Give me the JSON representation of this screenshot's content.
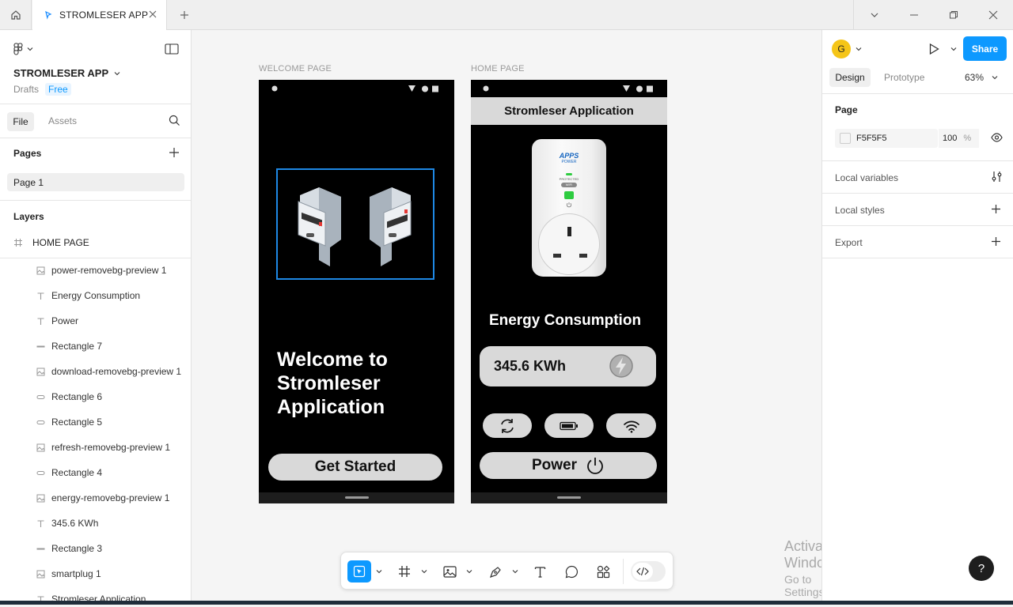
{
  "tabs": {
    "active_label": "STROMLESER APP"
  },
  "file": {
    "name": "STROMLESER APP",
    "location": "Drafts",
    "plan": "Free"
  },
  "left_tabs": {
    "file": "File",
    "assets": "Assets"
  },
  "pages": {
    "header": "Pages",
    "items": [
      "Page 1"
    ]
  },
  "layers": {
    "header": "Layers",
    "frame": "HOME PAGE",
    "items": [
      {
        "name": "power-removebg-preview 1",
        "icon": "image-icon"
      },
      {
        "name": "Energy Consumption",
        "icon": "text-icon"
      },
      {
        "name": "Power",
        "icon": "text-icon"
      },
      {
        "name": "Rectangle 7",
        "icon": "rectangle-icon"
      },
      {
        "name": "download-removebg-preview 1",
        "icon": "image-icon"
      },
      {
        "name": "Rectangle 6",
        "icon": "rounded-rectangle-icon"
      },
      {
        "name": "Rectangle 5",
        "icon": "rounded-rectangle-icon"
      },
      {
        "name": "refresh-removebg-preview 1",
        "icon": "image-icon"
      },
      {
        "name": "Rectangle 4",
        "icon": "rounded-rectangle-icon"
      },
      {
        "name": "energy-removebg-preview 1",
        "icon": "image-icon"
      },
      {
        "name": "345.6 KWh",
        "icon": "text-icon"
      },
      {
        "name": "Rectangle 3",
        "icon": "rectangle-icon"
      },
      {
        "name": "smartplug 1",
        "icon": "image-icon"
      },
      {
        "name": "Stromleser Application",
        "icon": "text-icon"
      }
    ]
  },
  "canvas": {
    "welcome": {
      "frame_label": "WELCOME PAGE",
      "heading_line1": "Welcome to",
      "heading_line2": "Stromleser",
      "heading_line3": "Application",
      "button": "Get Started"
    },
    "home": {
      "frame_label": "HOME PAGE",
      "app_title": "Stromleser Application",
      "plug_brand": "APPS",
      "plug_sub": "POWER",
      "plug_protected": "PROTECTED",
      "plug_wifi": "WIFI",
      "section_title": "Energy Consumption",
      "reading": "345.6 KWh",
      "power_button": "Power"
    }
  },
  "right_panel": {
    "avatar_letter": "G",
    "avatar_color": "#f5c518",
    "share": "Share",
    "tabs": {
      "design": "Design",
      "prototype": "Prototype"
    },
    "zoom": "63%",
    "page_header": "Page",
    "page_color": "F5F5F5",
    "page_opacity": "100",
    "opacity_unit": "%",
    "sections": [
      "Local variables",
      "Local styles",
      "Export"
    ]
  },
  "watermark": {
    "line1": "Activate Windows",
    "line2": "Go to Settings to activate Windows."
  },
  "help": "?",
  "colors": {
    "accent": "#0d99ff",
    "selection": "#1e88e5",
    "share_bg": "#0d99ff"
  }
}
